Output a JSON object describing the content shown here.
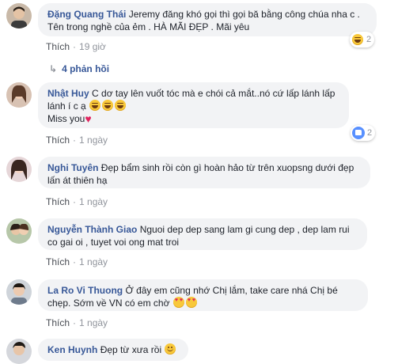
{
  "colors": {
    "author": "#385898",
    "bubble": "#f2f3f5",
    "meta": "#90949c"
  },
  "comments": [
    {
      "author": "Đặng Quang Thái",
      "text": "Jeremy đăng khó gọi thì gọi bă bằng công chúa nha c . Tên trong nghề của ẻm . HÀ MÃI ĐẸP . Mãi yêu",
      "like": "Thích",
      "time": "19 giờ",
      "reaction_icon": "laugh-emoji-icon",
      "reaction_count": "2"
    },
    {
      "author": "Nhật Huy",
      "text": "C dơ tay lên vuốt tóc mà e chói cả mắt..nó cứ lấp lánh lấp lánh í c ạ",
      "text2": "Miss you",
      "like": "Thích",
      "time": "1 ngày",
      "reaction_icon": "like-icon",
      "reaction_count": "2"
    },
    {
      "author": "Nghi Tuyên",
      "text": "Đẹp bẩm sinh rồi còn gì hoàn hảo từ trên xuopsng dưới đẹp lấn át thiên hạ",
      "like": "Thích",
      "time": "1 ngày"
    },
    {
      "author": "Nguyễn Thành Giao",
      "text": "Nguoi dep dep sang lam gi cung dep , dep lam rui co gai oi , tuyet voi ong mat troi",
      "like": "Thích",
      "time": "1 ngày"
    },
    {
      "author": "La Ro Vi Thuong",
      "text": "Ở đây em cũng nhớ Chị lắm, take care nhá Chị bé chẹp. Sớm về VN có em chờ",
      "like": "Thích",
      "time": "1 ngày"
    },
    {
      "author": "Ken Huynh",
      "text": "Đẹp từ xưa rồi"
    }
  ],
  "replies_link": "4 phản hồi"
}
